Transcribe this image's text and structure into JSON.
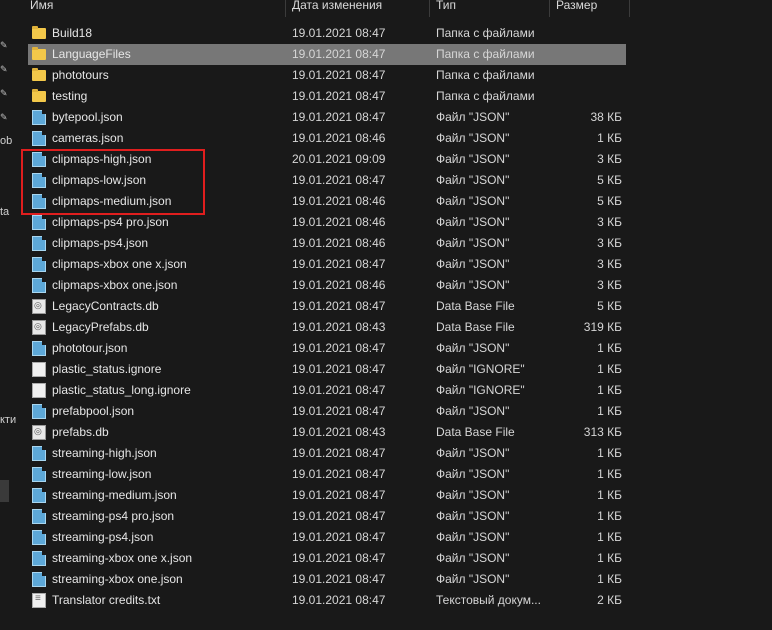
{
  "sidebar": {
    "fragments": [
      "ob",
      "ta",
      "кти"
    ]
  },
  "columns": {
    "name": "Имя",
    "date": "Дата изменения",
    "type": "Тип",
    "size": "Размер"
  },
  "accent": {
    "highlight_border": "#e01e1e",
    "selected_row": "#777777",
    "folder": "#f3c84a"
  },
  "files": [
    {
      "name": "Build18",
      "date": "19.01.2021 08:47",
      "type": "Папка с файлами",
      "size": "",
      "icon": "folder-icon"
    },
    {
      "name": "LanguageFiles",
      "date": "19.01.2021 08:47",
      "type": "Папка с файлами",
      "size": "",
      "icon": "folder-icon"
    },
    {
      "name": "phototours",
      "date": "19.01.2021 08:47",
      "type": "Папка с файлами",
      "size": "",
      "icon": "folder-icon"
    },
    {
      "name": "testing",
      "date": "19.01.2021 08:47",
      "type": "Папка с файлами",
      "size": "",
      "icon": "folder-icon"
    },
    {
      "name": "bytepool.json",
      "date": "19.01.2021 08:47",
      "type": "Файл \"JSON\"",
      "size": "38 КБ",
      "icon": "json-file-icon"
    },
    {
      "name": "cameras.json",
      "date": "19.01.2021 08:46",
      "type": "Файл \"JSON\"",
      "size": "1 КБ",
      "icon": "json-file-icon"
    },
    {
      "name": "clipmaps-high.json",
      "date": "20.01.2021 09:09",
      "type": "Файл \"JSON\"",
      "size": "3 КБ",
      "icon": "json-file-icon"
    },
    {
      "name": "clipmaps-low.json",
      "date": "19.01.2021 08:47",
      "type": "Файл \"JSON\"",
      "size": "5 КБ",
      "icon": "json-file-icon"
    },
    {
      "name": "clipmaps-medium.json",
      "date": "19.01.2021 08:46",
      "type": "Файл \"JSON\"",
      "size": "5 КБ",
      "icon": "json-file-icon"
    },
    {
      "name": "clipmaps-ps4 pro.json",
      "date": "19.01.2021 08:46",
      "type": "Файл \"JSON\"",
      "size": "3 КБ",
      "icon": "json-file-icon"
    },
    {
      "name": "clipmaps-ps4.json",
      "date": "19.01.2021 08:46",
      "type": "Файл \"JSON\"",
      "size": "3 КБ",
      "icon": "json-file-icon"
    },
    {
      "name": "clipmaps-xbox one x.json",
      "date": "19.01.2021 08:47",
      "type": "Файл \"JSON\"",
      "size": "3 КБ",
      "icon": "json-file-icon"
    },
    {
      "name": "clipmaps-xbox one.json",
      "date": "19.01.2021 08:46",
      "type": "Файл \"JSON\"",
      "size": "3 КБ",
      "icon": "json-file-icon"
    },
    {
      "name": "LegacyContracts.db",
      "date": "19.01.2021 08:47",
      "type": "Data Base File",
      "size": "5 КБ",
      "icon": "db-file-icon"
    },
    {
      "name": "LegacyPrefabs.db",
      "date": "19.01.2021 08:43",
      "type": "Data Base File",
      "size": "319 КБ",
      "icon": "db-file-icon"
    },
    {
      "name": "phototour.json",
      "date": "19.01.2021 08:47",
      "type": "Файл \"JSON\"",
      "size": "1 КБ",
      "icon": "json-file-icon"
    },
    {
      "name": "plastic_status.ignore",
      "date": "19.01.2021 08:47",
      "type": "Файл \"IGNORE\"",
      "size": "1 КБ",
      "icon": "plain-file-icon"
    },
    {
      "name": "plastic_status_long.ignore",
      "date": "19.01.2021 08:47",
      "type": "Файл \"IGNORE\"",
      "size": "1 КБ",
      "icon": "plain-file-icon"
    },
    {
      "name": "prefabpool.json",
      "date": "19.01.2021 08:47",
      "type": "Файл \"JSON\"",
      "size": "1 КБ",
      "icon": "json-file-icon"
    },
    {
      "name": "prefabs.db",
      "date": "19.01.2021 08:43",
      "type": "Data Base File",
      "size": "313 КБ",
      "icon": "db-file-icon"
    },
    {
      "name": "streaming-high.json",
      "date": "19.01.2021 08:47",
      "type": "Файл \"JSON\"",
      "size": "1 КБ",
      "icon": "json-file-icon"
    },
    {
      "name": "streaming-low.json",
      "date": "19.01.2021 08:47",
      "type": "Файл \"JSON\"",
      "size": "1 КБ",
      "icon": "json-file-icon"
    },
    {
      "name": "streaming-medium.json",
      "date": "19.01.2021 08:47",
      "type": "Файл \"JSON\"",
      "size": "1 КБ",
      "icon": "json-file-icon"
    },
    {
      "name": "streaming-ps4 pro.json",
      "date": "19.01.2021 08:47",
      "type": "Файл \"JSON\"",
      "size": "1 КБ",
      "icon": "json-file-icon"
    },
    {
      "name": "streaming-ps4.json",
      "date": "19.01.2021 08:47",
      "type": "Файл \"JSON\"",
      "size": "1 КБ",
      "icon": "json-file-icon"
    },
    {
      "name": "streaming-xbox one x.json",
      "date": "19.01.2021 08:47",
      "type": "Файл \"JSON\"",
      "size": "1 КБ",
      "icon": "json-file-icon"
    },
    {
      "name": "streaming-xbox one.json",
      "date": "19.01.2021 08:47",
      "type": "Файл \"JSON\"",
      "size": "1 КБ",
      "icon": "json-file-icon"
    },
    {
      "name": "Translator credits.txt",
      "date": "19.01.2021 08:47",
      "type": "Текстовый докум...",
      "size": "2 КБ",
      "icon": "text-file-icon"
    }
  ]
}
